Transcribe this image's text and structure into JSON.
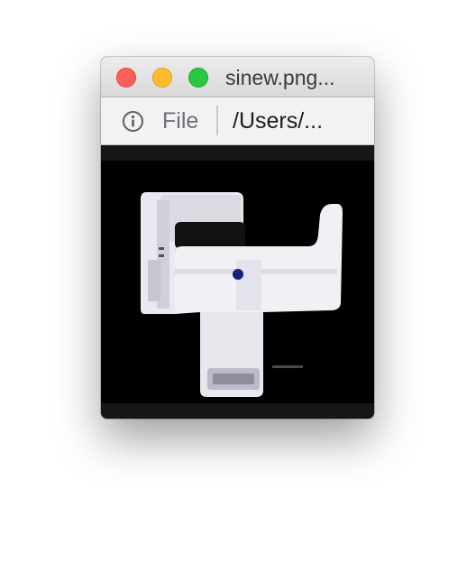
{
  "window": {
    "title": "sinew.png..."
  },
  "toolbar": {
    "info_icon": "info-circle-icon",
    "file_label": "File",
    "path_label": "/Users/..."
  },
  "colors": {
    "close": "#fc5f57",
    "minimize": "#fdbc2e",
    "zoom": "#28c840",
    "preview_background": "#000000"
  }
}
